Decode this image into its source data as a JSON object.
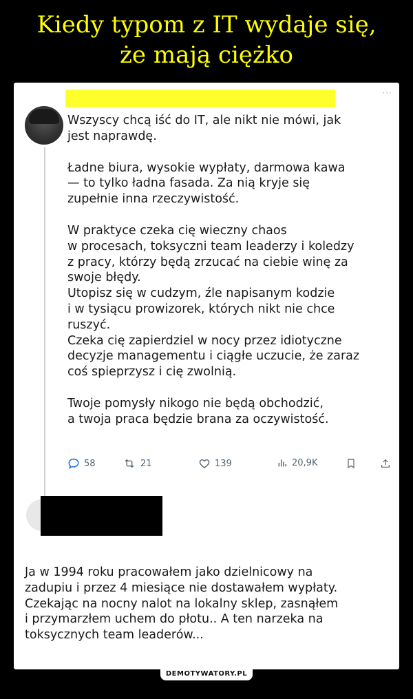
{
  "title_lines": [
    "Kiedy typom z IT wydaje się,",
    "że mają ciężko"
  ],
  "tweet": {
    "paragraphs": [
      "Wszyscy chcą iść do IT, ale nikt nie mówi, jak\njest naprawdę.",
      "Ładne biura, wysokie wypłaty, darmowa kawa\n— to tylko ładna fasada. Za nią kryje się\nzupełnie inna rzeczywistość.",
      "W praktyce czeka cię wieczny chaos\nw procesach, toksyczni team leaderzy i koledzy\nz pracy, którzy będą zrzucać na ciebie winę za\nswoje błędy.",
      "Utopisz się w cudzym, źle napisanym kodzie\ni w tysiącu prowizorek, których nikt nie chce\nruszyć.",
      "Czeka cię zapierdziel w nocy przez idiotyczne\ndecyzje managementu i ciągłe uczucie, że zaraz\ncoś spieprzysz i cię zwolnią.",
      "Twoje pomysły nikogo nie będą obchodzić,\na twoja praca będzie brana za oczywistość."
    ],
    "stats": {
      "replies": "58",
      "retweets": "21",
      "likes": "139",
      "views": "20,9K"
    },
    "icons": [
      "reply-icon",
      "retweet-icon",
      "like-icon",
      "views-icon",
      "bookmark-icon",
      "share-icon"
    ],
    "more_glyph": "···"
  },
  "reply": {
    "text": "Ja w 1994 roku pracowałem jako dzielnicowy na\nzadupiu i przez 4 miesiące nie dostawałem wypłaty.\nCzekając na nocny nalot na lokalny sklep, zasnąłem\ni przymarzłem uchem do płotu.. A ten narzeka na\ntoksycznych team leaderów..."
  },
  "watermark": "DEMOTYWATORY.PL",
  "colors": {
    "background": "#000000",
    "title": "#ffff00",
    "redaction_yellow": "#ffff2b",
    "redaction_black": "#000000",
    "icon_gray": "#536471"
  }
}
